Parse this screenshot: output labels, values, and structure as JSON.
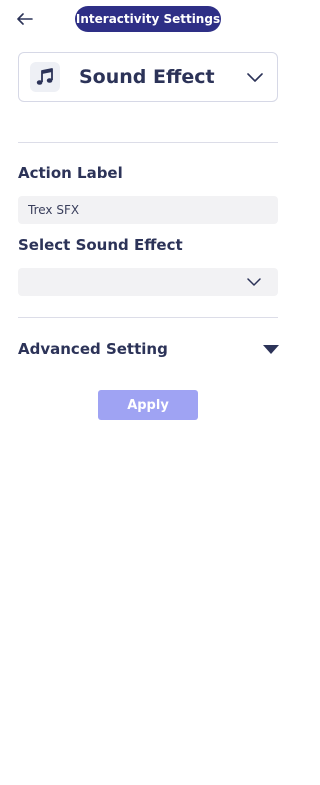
{
  "header": {
    "back_icon": "arrow-left-icon",
    "title": "Interactivity Settings",
    "pill_color": "#2e2f86"
  },
  "interaction_type": {
    "icon": "music-note-icon",
    "label": "Sound Effect",
    "chevron_icon": "chevron-down-icon"
  },
  "action_label": {
    "label": "Action Label",
    "value": "Trex SFX"
  },
  "sound_effect": {
    "label": "Select Sound Effect",
    "value": "",
    "chevron_icon": "chevron-down-icon"
  },
  "advanced": {
    "label": "Advanced Setting",
    "toggle_icon": "caret-down-icon"
  },
  "apply": {
    "label": "Apply",
    "color": "#9fa3f3"
  }
}
